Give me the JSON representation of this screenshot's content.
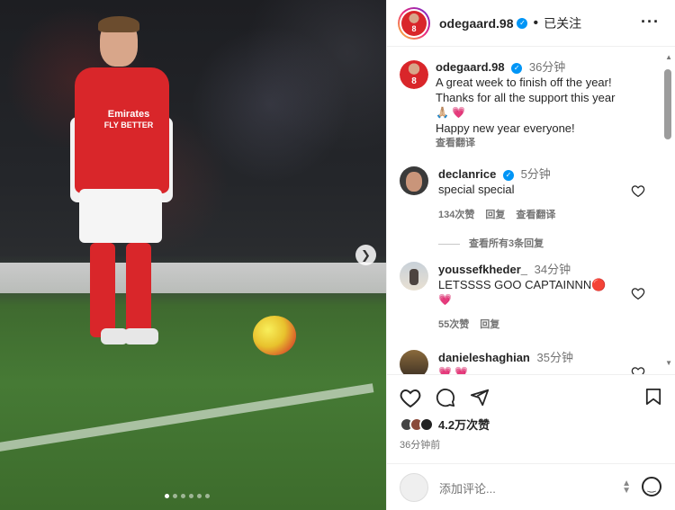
{
  "photo": {
    "sponsor_line1": "Emirates",
    "sponsor_line2": "FLY BETTER",
    "carousel_total": 6,
    "carousel_active": 1
  },
  "header": {
    "username": "odegaard.98",
    "follow_status": "已关注",
    "avatar_number": "8"
  },
  "caption": {
    "username": "odegaard.98",
    "time": "36分钟",
    "line1": "A great week to finish off the year!",
    "line2": "Thanks for all the support this year",
    "emojis": "🙏🏼 💗",
    "line3": "Happy new year everyone!",
    "translate": "查看翻译"
  },
  "comments": [
    {
      "username": "declanrice",
      "time": "5分钟",
      "text": "special special",
      "likes": "134次赞",
      "reply": "回复",
      "translate": "查看翻译",
      "view_replies": "查看所有3条回复"
    },
    {
      "username": "youssefkheder_",
      "time": "34分钟",
      "text": "LETSSSS GOO CAPTAINNN🔴",
      "text2": "💗",
      "likes": "55次赞",
      "reply": "回复"
    },
    {
      "username": "danieleshaghian",
      "time": "35分钟",
      "text": "💗 💗"
    }
  ],
  "actions": {
    "likes_count": "4.2万次赞",
    "post_date": "36分钟前",
    "comment_placeholder": "添加评论..."
  },
  "icons": {
    "more": "more-options-icon",
    "like": "heart-icon",
    "comment": "comment-icon",
    "share": "share-icon",
    "save": "bookmark-icon",
    "emoji": "emoji-icon",
    "verified": "verified-badge-icon"
  },
  "colors": {
    "arsenal_red": "#d9262a",
    "verified_blue": "#0095f6",
    "heart_pink": "#ed4956",
    "text": "#262626",
    "secondary_text": "#737373"
  }
}
